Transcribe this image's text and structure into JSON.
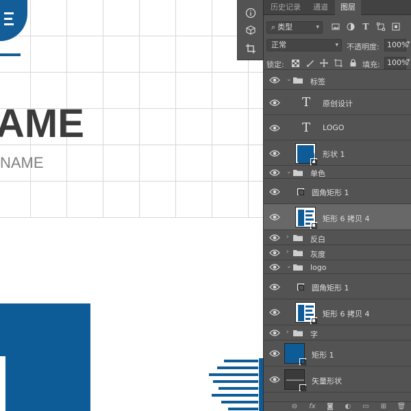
{
  "canvas": {
    "title_large": "AME",
    "title_small": "NAME",
    "brand_blue": "#0e5c97"
  },
  "panel_tabs": [
    "历史记录",
    "通道",
    "图层"
  ],
  "active_tab": "图层",
  "filter": {
    "kind_label": "类型"
  },
  "blend": {
    "mode": "正常",
    "opacity_label": "不透明度:",
    "opacity_value": "100%"
  },
  "lock": {
    "label": "锁定:",
    "fill_label": "填充:",
    "fill_value": "100%"
  },
  "layers": [
    {
      "name": "标签",
      "kind": "group",
      "expanded": true,
      "indent": 0
    },
    {
      "name": "原创设计",
      "kind": "text",
      "indent": 1
    },
    {
      "name": "LOGO",
      "kind": "text",
      "indent": 1
    },
    {
      "name": "形状 1",
      "kind": "shape-thumb",
      "indent": 1
    },
    {
      "name": "单色",
      "kind": "group",
      "expanded": true,
      "indent": 0
    },
    {
      "name": "圆角矩形 1",
      "kind": "path",
      "indent": 1
    },
    {
      "name": "矩形 6 拷贝 4",
      "kind": "image-thumb",
      "indent": 1,
      "selected": true
    },
    {
      "name": "反白",
      "kind": "group",
      "expanded": false,
      "indent": 0
    },
    {
      "name": "灰度",
      "kind": "group",
      "expanded": false,
      "indent": 0
    },
    {
      "name": "logo",
      "kind": "group",
      "expanded": true,
      "indent": 0
    },
    {
      "name": "圆角矩形 1",
      "kind": "path",
      "indent": 1
    },
    {
      "name": "矩形 6 拷贝 4",
      "kind": "image-thumb",
      "indent": 1
    },
    {
      "name": "字",
      "kind": "group",
      "expanded": false,
      "indent": 0
    },
    {
      "name": "矩形 1",
      "kind": "blue-thumb",
      "indent": 0
    },
    {
      "name": "矢量形状",
      "kind": "vector-thumb",
      "indent": 0
    }
  ],
  "icons": {
    "filter": [
      "image-filter-icon",
      "adjustment-filter-icon",
      "type-filter-icon",
      "shape-filter-icon",
      "smart-object-filter-icon"
    ],
    "lock": [
      "lock-transparent-icon",
      "lock-paint-icon",
      "lock-position-icon",
      "lock-artboard-icon",
      "lock-all-icon"
    ],
    "bottom": [
      "link-icon",
      "fx-icon",
      "mask-icon",
      "adjustment-icon",
      "new-group-icon",
      "new-layer-icon",
      "delete-icon"
    ]
  }
}
